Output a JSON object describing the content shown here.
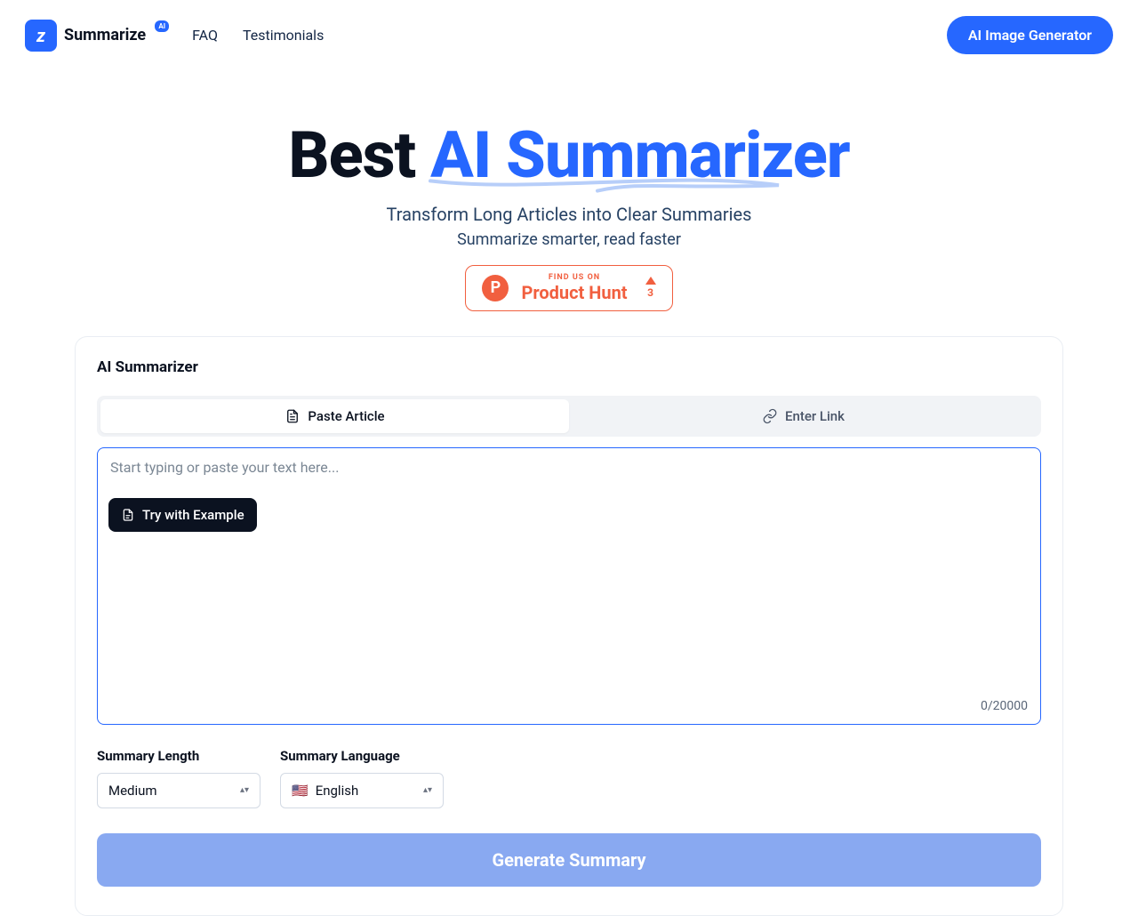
{
  "brand": {
    "name": "Summarize",
    "badge": "AI"
  },
  "nav": {
    "faq": "FAQ",
    "testimonials": "Testimonials"
  },
  "cta_header": "AI Image Generator",
  "hero": {
    "title_prefix": "Best ",
    "title_accent": "AI Summarizer",
    "subtitle": "Transform Long Articles into Clear Summaries",
    "subtitle2": "Summarize smarter, read faster"
  },
  "ph": {
    "small": "FIND US ON",
    "large": "Product Hunt",
    "votes": "3"
  },
  "card": {
    "title": "AI Summarizer",
    "tabs": {
      "paste": "Paste Article",
      "link": "Enter Link"
    },
    "placeholder": "Start typing or paste your text here...",
    "try_btn": "Try with Example",
    "counter": "0/20000",
    "length_label": "Summary Length",
    "length_value": "Medium",
    "lang_label": "Summary Language",
    "lang_value": "English",
    "lang_icon": "🇺🇸",
    "generate": "Generate Summary"
  }
}
